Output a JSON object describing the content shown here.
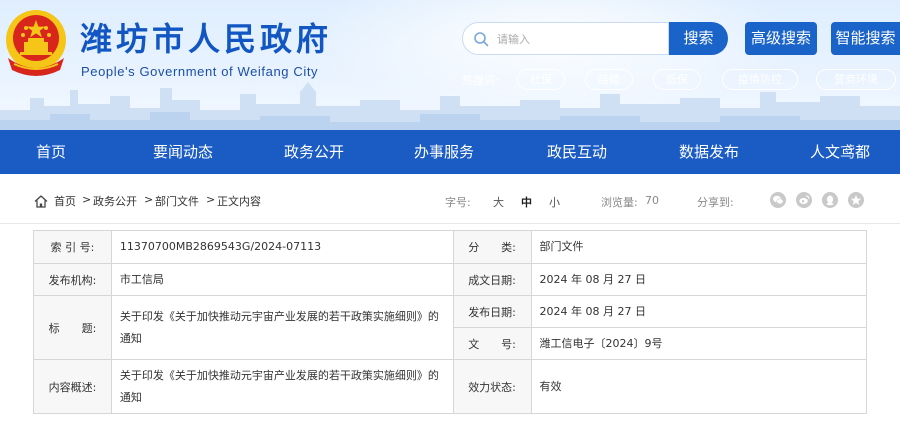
{
  "header": {
    "title": "潍坊市人民政府",
    "subtitle": "People's Government of Weifang City",
    "search": {
      "placeholder": "请输入",
      "button": "搜索",
      "advanced_button": "高级搜索",
      "smart_button": "智能搜索"
    },
    "hot_label": "热搜词:",
    "hot_tags": [
      "社保",
      "结婚",
      "低保",
      "疫情防控",
      "营商环境"
    ]
  },
  "nav": {
    "items": [
      "首页",
      "要闻动态",
      "政务公开",
      "办事服务",
      "政民互动",
      "数据发布",
      "人文鸢都"
    ]
  },
  "breadcrumb": {
    "items": [
      "首页",
      "政务公开",
      "部门文件",
      "正文内容"
    ],
    "separator": ">"
  },
  "toolbar": {
    "font_label": "字号:",
    "font_sizes": [
      "大",
      "中",
      "小"
    ],
    "views_label": "浏览量:",
    "views": "70",
    "share_label": "分享到:",
    "share_icons": [
      "wechat-icon",
      "weibo-icon",
      "qq-icon",
      "qzone-icon"
    ]
  },
  "info": {
    "index_label": "索 引 号:",
    "index_value": "11370700MB2869543G/2024-07113",
    "category_label": "分　　类:",
    "category_value": "部门文件",
    "publisher_label": "发布机构:",
    "publisher_value": "市工信局",
    "written_label": "成文日期:",
    "written_value": "2024 年 08 月 27 日",
    "title_label": "标　　题:",
    "title_value": "关于印发《关于加快推动元宇宙产业发展的若干政策实施细则》的通知",
    "published_label": "发布日期:",
    "published_value": "2024 年 08 月 27 日",
    "docno_label": "文　　号:",
    "docno_value": "潍工信电子〔2024〕9号",
    "summary_label": "内容概述:",
    "summary_value": "关于印发《关于加快推动元宇宙产业发展的若干政策实施细则》的通知",
    "validity_label": "效力状态:",
    "validity_value": "有效"
  },
  "colors": {
    "brand_blue": "#1a5bc4",
    "title_blue": "#1156c2",
    "emblem_red": "#d9261c",
    "emblem_gold": "#f5c518"
  }
}
